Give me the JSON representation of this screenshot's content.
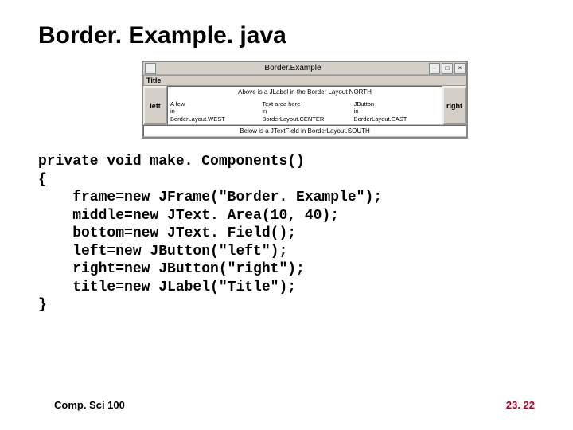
{
  "title": "Border. Example. java",
  "window": {
    "title": "Border.Example",
    "north_label": "Title",
    "center_header": "Above is a JLabel in the Border Layout NORTH",
    "col1_a": "A few",
    "col1_b": "in",
    "col1_c": "BorderLayout.WEST",
    "col2_a": "Text area here",
    "col2_b": "in",
    "col2_c": "BorderLayout.CENTER",
    "col3_a": "JButton",
    "col3_b": "in",
    "col3_c": "BorderLayout.EAST",
    "west_btn": "left",
    "east_btn": "right",
    "south_text": "Below is a JTextField in BorderLayout.SOUTH"
  },
  "code": {
    "l1": "private void make. Components()",
    "l2": "{",
    "l3": "    frame=new JFrame(\"Border. Example\");",
    "l4": "    middle=new JText. Area(10, 40);",
    "l5": "    bottom=new JText. Field();",
    "l6": "    left=new JButton(\"left\");",
    "l7": "    right=new JButton(\"right\");",
    "l8": "    title=new JLabel(\"Title\");",
    "l9": "}"
  },
  "footer": {
    "course": "Comp. Sci 100",
    "page": "23. 22"
  }
}
